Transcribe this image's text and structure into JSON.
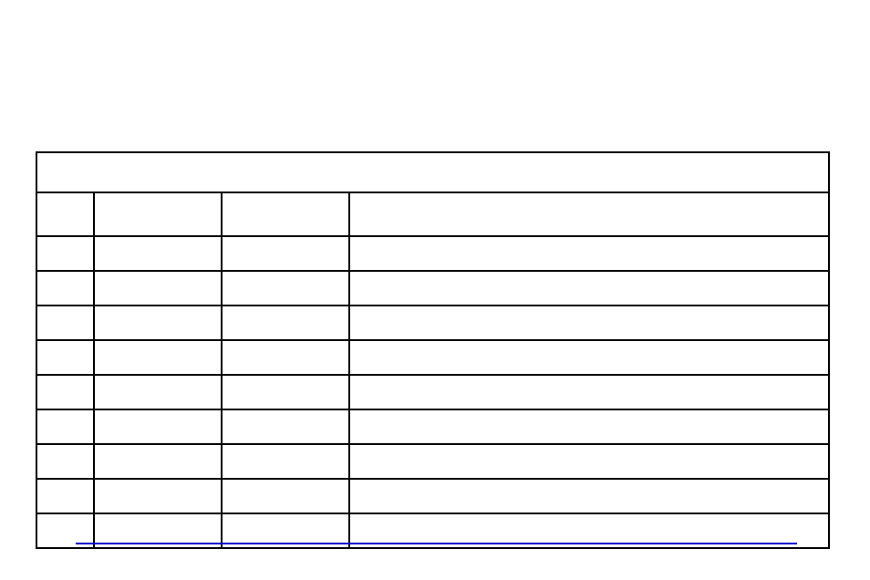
{
  "table": {
    "title": "",
    "headers": [
      "",
      "",
      "",
      ""
    ],
    "rows": [
      [
        "",
        "",
        "",
        ""
      ],
      [
        "",
        "",
        "",
        ""
      ],
      [
        "",
        "",
        "",
        ""
      ],
      [
        "",
        "",
        "",
        ""
      ],
      [
        "",
        "",
        "",
        ""
      ],
      [
        "",
        "",
        "",
        ""
      ],
      [
        "",
        "",
        "",
        ""
      ],
      [
        "",
        "",
        "",
        ""
      ],
      [
        "",
        "",
        "",
        ""
      ]
    ]
  }
}
